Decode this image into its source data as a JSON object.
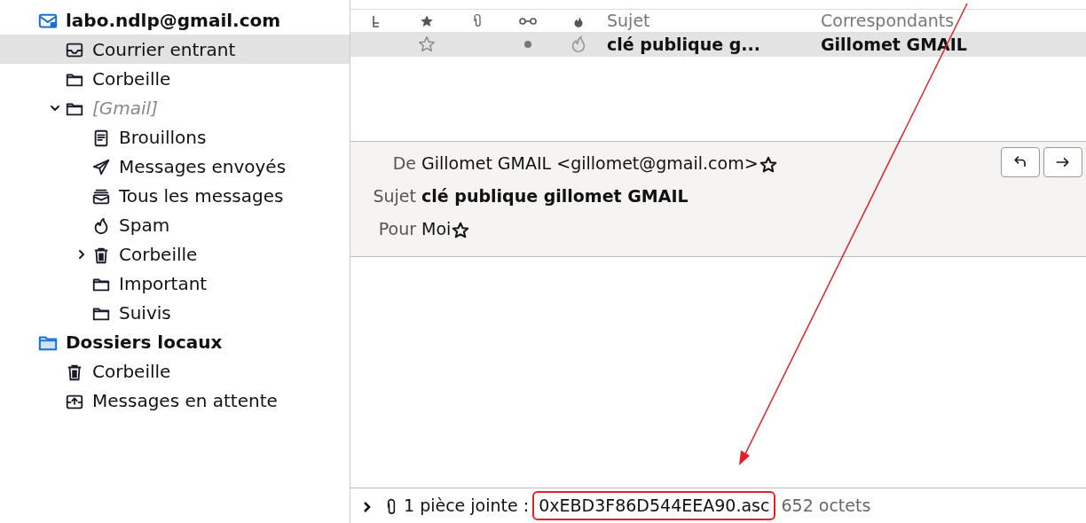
{
  "folder_tree": [
    {
      "label": "labo.ndlp@gmail.com",
      "kind": "account",
      "selected": false,
      "children": [
        {
          "label": "Courrier entrant",
          "kind": "inbox",
          "selected": true
        },
        {
          "label": "Corbeille",
          "kind": "folder",
          "selected": false
        },
        {
          "label": "[Gmail]",
          "kind": "virtual",
          "selected": false,
          "expanded": true,
          "children": [
            {
              "label": "Brouillons",
              "kind": "drafts",
              "selected": false
            },
            {
              "label": "Messages envoyés",
              "kind": "sent",
              "selected": false
            },
            {
              "label": "Tous les messages",
              "kind": "archive",
              "selected": false
            },
            {
              "label": "Spam",
              "kind": "spam",
              "selected": false
            },
            {
              "label": "Corbeille",
              "kind": "trash",
              "selected": false,
              "expanded": false
            },
            {
              "label": "Important",
              "kind": "folder",
              "selected": false
            },
            {
              "label": "Suivis",
              "kind": "folder",
              "selected": false
            }
          ]
        }
      ]
    },
    {
      "label": "Dossiers locaux",
      "kind": "local",
      "selected": false,
      "children": [
        {
          "label": "Corbeille",
          "kind": "trash",
          "selected": false
        },
        {
          "label": "Messages en attente",
          "kind": "outbox",
          "selected": false
        }
      ]
    }
  ],
  "message_list": {
    "columns": [
      {
        "kind": "thread"
      },
      {
        "kind": "star"
      },
      {
        "kind": "attachment"
      },
      {
        "kind": "read"
      },
      {
        "kind": "junk"
      },
      {
        "kind": "text",
        "label": "Sujet"
      },
      {
        "kind": "text",
        "label": "Correspondants"
      }
    ],
    "rows": [
      {
        "starred": false,
        "unread": true,
        "subject": "clé publique g...",
        "correspondent": "Gillomet GMAIL",
        "selected": true
      }
    ]
  },
  "message_header": {
    "fields": [
      {
        "label": "De",
        "value": "Gillomet GMAIL <gillomet@gmail.com>",
        "bold": false,
        "starred": false
      },
      {
        "label": "Sujet",
        "value": "clé publique gillomet GMAIL",
        "bold": true
      },
      {
        "label": "Pour",
        "value": "Moi",
        "bold": false,
        "starred": false
      }
    ],
    "buttons": [
      {
        "kind": "reply"
      },
      {
        "kind": "forward"
      }
    ]
  },
  "attachment_bar": {
    "expanded": false,
    "summary": "1 pièce jointe :",
    "filename": "0xEBD3F86D544EEA90.asc",
    "size": "652 octets",
    "highlighted": true
  },
  "annotation": {
    "arrow": true
  }
}
